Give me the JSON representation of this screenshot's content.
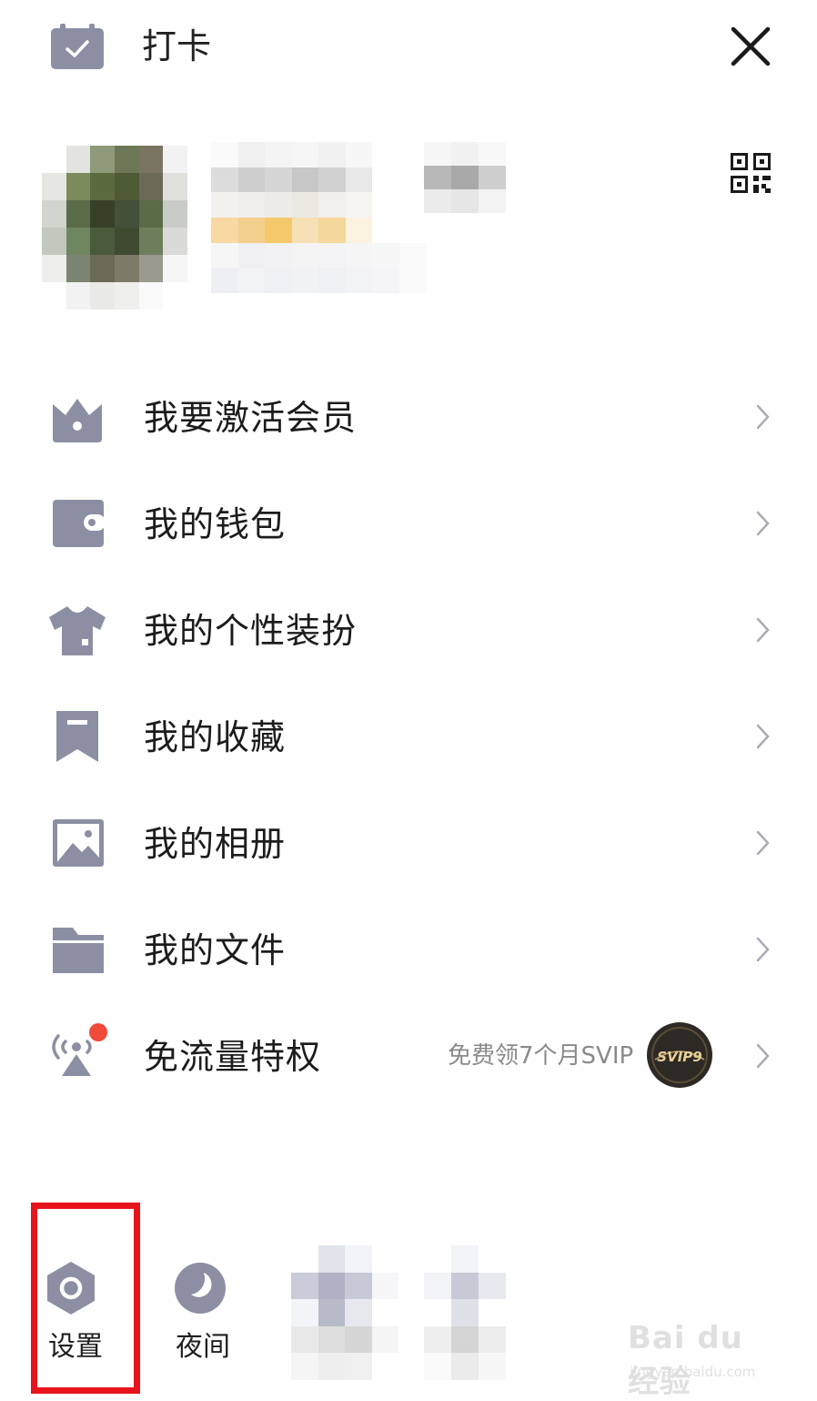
{
  "header": {
    "checkin_label": "打卡"
  },
  "menu": [
    {
      "label": "我要激活会员",
      "icon": "crown-icon"
    },
    {
      "label": "我的钱包",
      "icon": "wallet-icon"
    },
    {
      "label": "我的个性装扮",
      "icon": "tshirt-icon"
    },
    {
      "label": "我的收藏",
      "icon": "bookmark-icon"
    },
    {
      "label": "我的相册",
      "icon": "photo-icon"
    },
    {
      "label": "我的文件",
      "icon": "folder-icon"
    },
    {
      "label": "免流量特权",
      "icon": "signal-tower-icon",
      "promo": "免费领7个月SVIP",
      "badge": "SVIP9"
    }
  ],
  "bottom": {
    "settings_label": "设置",
    "night_label": "夜间"
  },
  "watermark": {
    "text": "Bai du 经验",
    "url": "jingyan.baidu.com"
  },
  "colors": {
    "icon_gray": "#8c8fa3",
    "highlight_red": "#e8141b",
    "notification_dot": "#f04a3a",
    "blur_yellow": "#f5c96b"
  }
}
